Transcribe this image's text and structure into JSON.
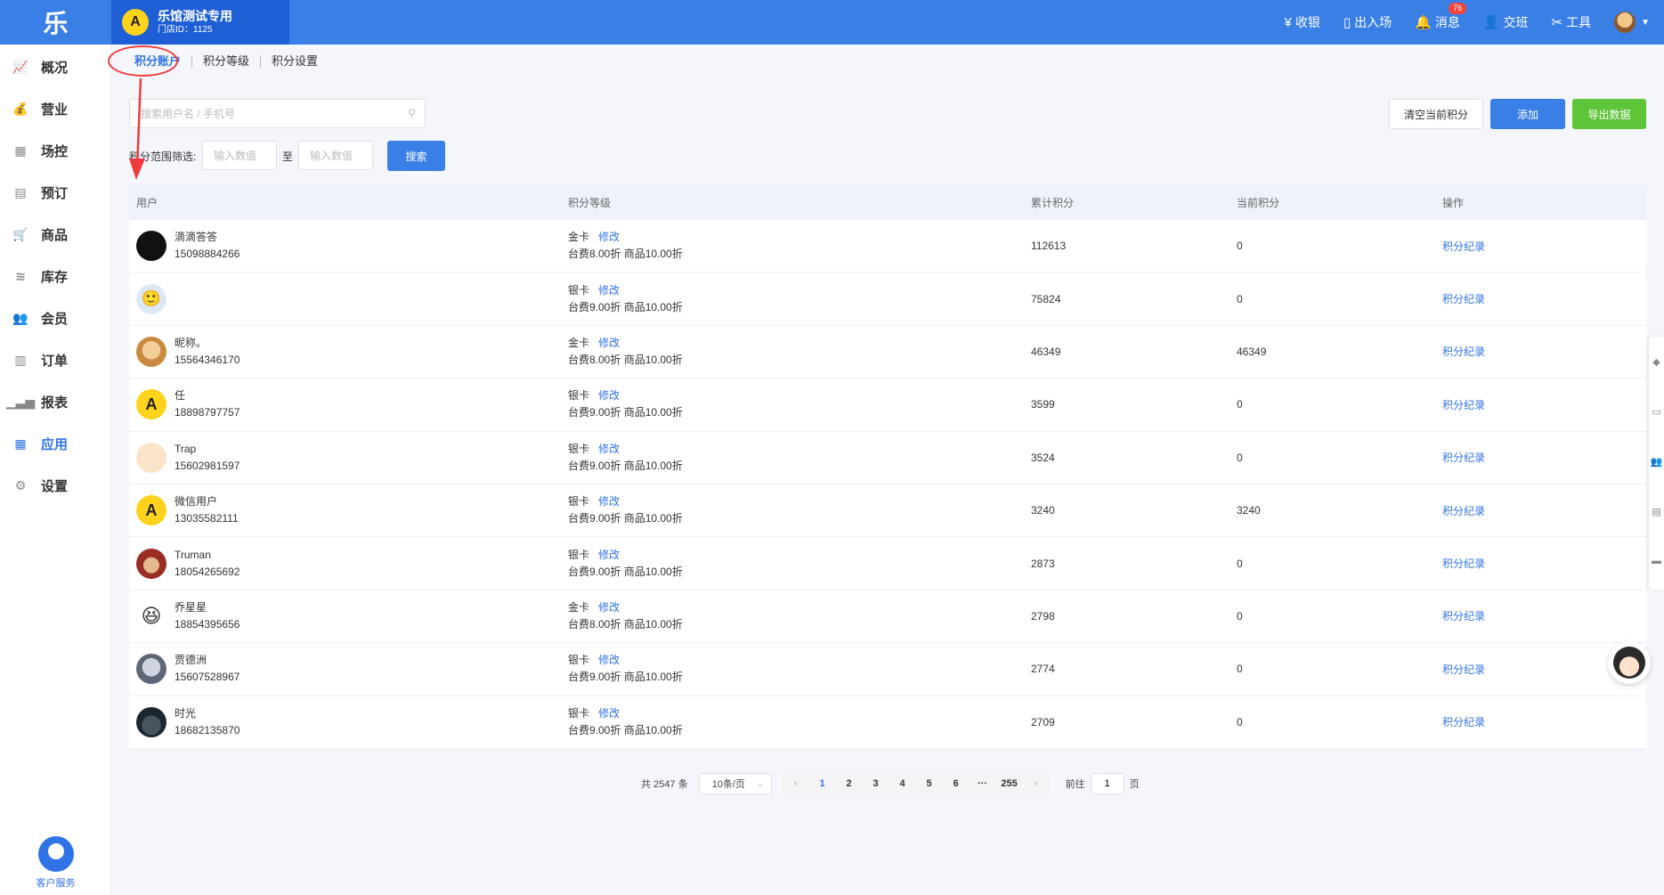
{
  "app": {
    "logo_char": "乐",
    "store_name": "乐馆测试专用",
    "store_id": "门店ID：1125",
    "store_logo_char": "A"
  },
  "topbar": {
    "actions": [
      {
        "icon": "cashier-icon",
        "glyph": "¥",
        "label": "收银"
      },
      {
        "icon": "door-icon",
        "glyph": "▯",
        "label": "出入场"
      },
      {
        "icon": "bell-icon",
        "glyph": "🔔",
        "label": "消息",
        "badge": "76"
      },
      {
        "icon": "user-switch-icon",
        "glyph": "👤",
        "label": "交班"
      },
      {
        "icon": "tools-icon",
        "glyph": "✂",
        "label": "工具"
      }
    ]
  },
  "sidebar": {
    "items": [
      {
        "name": "overview",
        "icon": "chart-line-icon",
        "glyph": "📈",
        "label": "概况"
      },
      {
        "name": "business",
        "icon": "money-bag-icon",
        "glyph": "💰",
        "label": "营业"
      },
      {
        "name": "venue",
        "icon": "calendar-grid-icon",
        "glyph": "▦",
        "label": "场控"
      },
      {
        "name": "booking",
        "icon": "calendar-icon",
        "glyph": "▤",
        "label": "预订"
      },
      {
        "name": "goods",
        "icon": "cart-icon",
        "glyph": "🛒",
        "label": "商品"
      },
      {
        "name": "stock",
        "icon": "layers-icon",
        "glyph": "≋",
        "label": "库存"
      },
      {
        "name": "member",
        "icon": "members-icon",
        "glyph": "👥",
        "label": "会员"
      },
      {
        "name": "order",
        "icon": "order-icon",
        "glyph": "▥",
        "label": "订单"
      },
      {
        "name": "report",
        "icon": "bar-chart-icon",
        "glyph": "▁▃▅",
        "label": "报表"
      },
      {
        "name": "apps",
        "icon": "apps-grid-icon",
        "glyph": "▦",
        "label": "应用",
        "active": true
      },
      {
        "name": "settings",
        "icon": "gear-icon",
        "glyph": "⚙",
        "label": "设置"
      }
    ],
    "customer_service": "客户服务"
  },
  "tabs": [
    {
      "label": "积分账户",
      "active": true
    },
    {
      "label": "积分等级"
    },
    {
      "label": "积分设置"
    }
  ],
  "filters": {
    "search_placeholder": "搜索用户名 / 手机号",
    "range_label": "积分范围筛选:",
    "range_min_placeholder": "输入数值",
    "range_to": "至",
    "range_max_placeholder": "输入数值",
    "search_button": "搜索"
  },
  "actions": {
    "clear_button": "清空当前积分",
    "add_button": "添加",
    "export_button": "导出数据"
  },
  "table": {
    "headers": {
      "user": "用户",
      "level": "积分等级",
      "total": "累计积分",
      "current": "当前积分",
      "op": "操作"
    },
    "edit_label": "修改",
    "op_label": "积分纪录",
    "rows": [
      {
        "name": "滴滴答答",
        "phone": "15098884266",
        "card": "金卡",
        "discount": "台费8.00折 商品10.00折",
        "total": "112613",
        "current": "0"
      },
      {
        "name": "",
        "phone": "",
        "card": "银卡",
        "discount": "台费9.00折 商品10.00折",
        "total": "75824",
        "current": "0"
      },
      {
        "name": "昵称。",
        "phone": "15564346170",
        "card": "金卡",
        "discount": "台费8.00折 商品10.00折",
        "total": "46349",
        "current": "46349"
      },
      {
        "name": "任",
        "phone": "18898797757",
        "card": "银卡",
        "discount": "台费9.00折 商品10.00折",
        "total": "3599",
        "current": "0"
      },
      {
        "name": "Trap",
        "phone": "15602981597",
        "card": "银卡",
        "discount": "台费9.00折 商品10.00折",
        "total": "3524",
        "current": "0"
      },
      {
        "name": "微信用户",
        "phone": "13035582111",
        "card": "银卡",
        "discount": "台费9.00折 商品10.00折",
        "total": "3240",
        "current": "3240"
      },
      {
        "name": "Truman",
        "phone": "18054265692",
        "card": "银卡",
        "discount": "台费9.00折 商品10.00折",
        "total": "2873",
        "current": "0"
      },
      {
        "name": "乔星星",
        "phone": "18854395656",
        "card": "金卡",
        "discount": "台费8.00折 商品10.00折",
        "total": "2798",
        "current": "0"
      },
      {
        "name": "贾德洲",
        "phone": "15607528967",
        "card": "银卡",
        "discount": "台费9.00折 商品10.00折",
        "total": "2774",
        "current": "0"
      },
      {
        "name": "时光",
        "phone": "18682135870",
        "card": "银卡",
        "discount": "台费9.00折 商品10.00折",
        "total": "2709",
        "current": "0"
      }
    ]
  },
  "pagination": {
    "total": "共 2547 条",
    "page_size": "10条/页",
    "pages": [
      "1",
      "2",
      "3",
      "4",
      "5",
      "6",
      "···",
      "255"
    ],
    "current_page": "1",
    "goto_label": "前往",
    "goto_value": "1",
    "goto_suffix": "页"
  },
  "colors": {
    "primary": "#3a7fe6",
    "success": "#5ec43a",
    "annotation": "#ef3b3b"
  }
}
